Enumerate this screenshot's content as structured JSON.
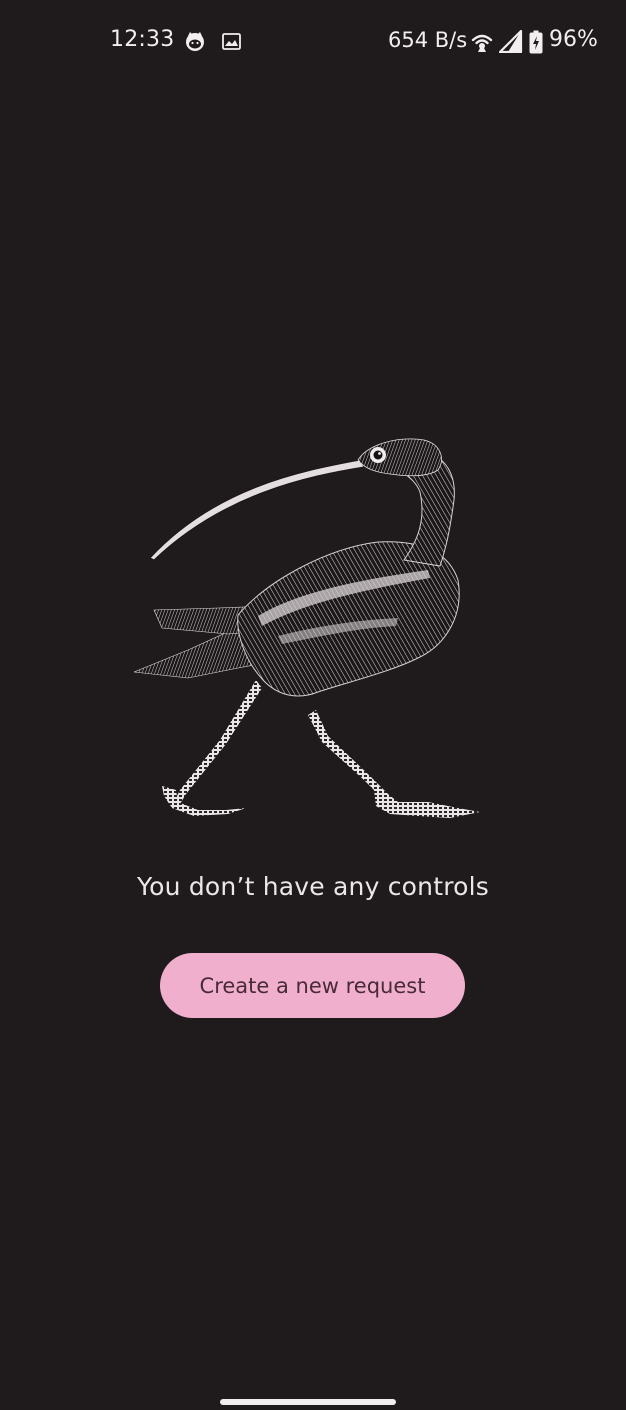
{
  "status_bar": {
    "time": "12:33",
    "net_speed": "654 B/s",
    "battery_percent": "96%",
    "icons": [
      "cat-notification-icon",
      "image-notification-icon",
      "hotspot-icon",
      "signal-icon",
      "battery-charging-icon"
    ]
  },
  "illustration": {
    "subject": "curlew-bird-engraving-icon"
  },
  "empty_state": {
    "message": "You don’t have any controls",
    "button_label": "Create a new request"
  },
  "colors": {
    "background": "#1f1b1d",
    "button_fill": "#f0b0cd",
    "button_text": "#4a2a38",
    "text": "#ece6e8"
  }
}
